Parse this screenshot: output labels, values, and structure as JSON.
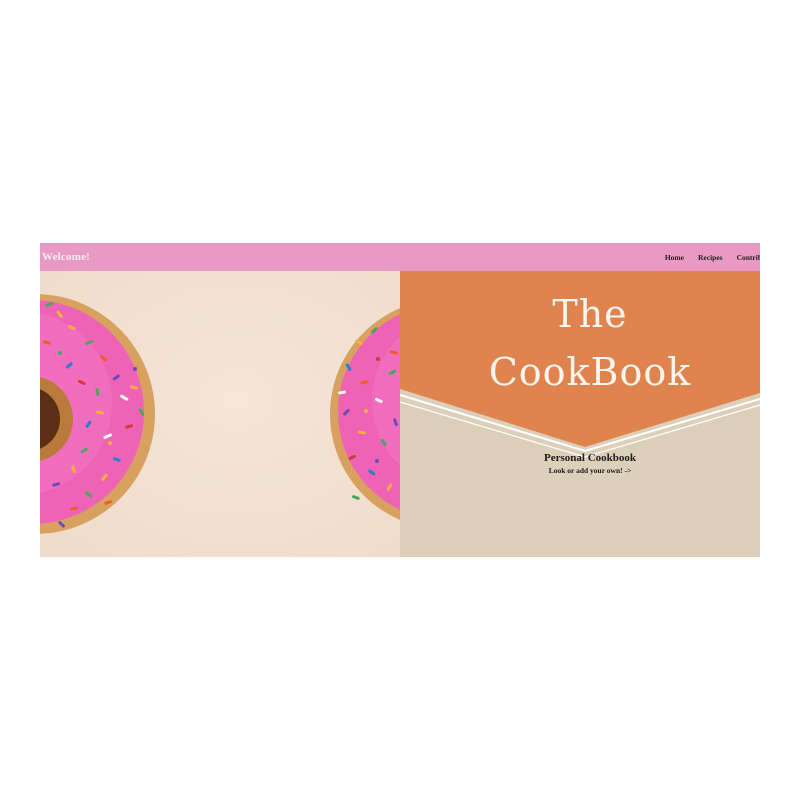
{
  "navbar": {
    "welcome": "Welcome!",
    "links": [
      "Home",
      "Recipes",
      "Contribute"
    ]
  },
  "hero": {
    "title_line1": "The",
    "title_line2": "CookBook",
    "subtitle": "Personal Cookbook",
    "cta": "Look or add your own! ->"
  },
  "colors": {
    "navbar": "#e89ac4",
    "banner": "#e0844f",
    "right_background": "#ddd0bb",
    "left_background": "#f3e2d4",
    "frosting": "#ef63b6"
  },
  "images": {
    "left_donut": "pink-frosted-donut-with-sprinkles",
    "right_donut": "pink-frosted-donut-with-sprinkles"
  }
}
